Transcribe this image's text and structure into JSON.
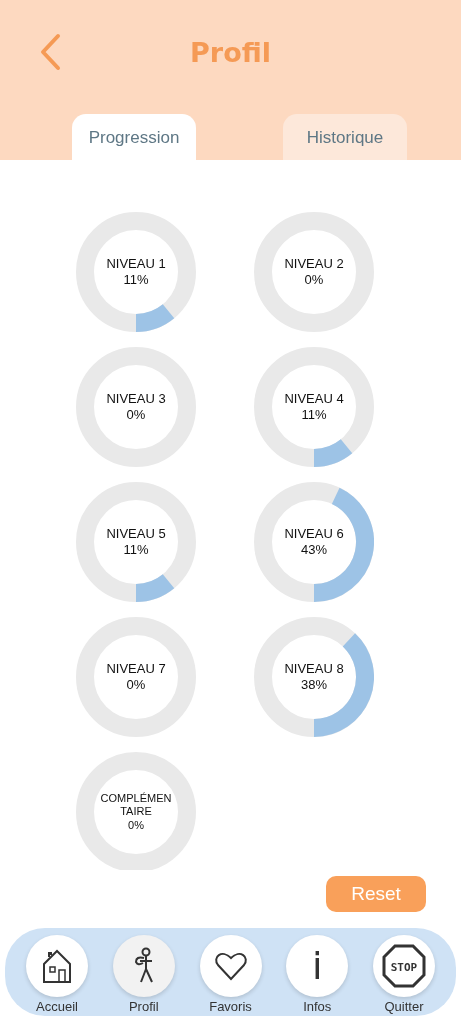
{
  "header": {
    "title": "Profil"
  },
  "tabs": [
    {
      "label": "Progression",
      "selected": true
    },
    {
      "label": "Historique",
      "selected": false
    }
  ],
  "levels": [
    {
      "name": "NIVEAU 1",
      "percent": "11%"
    },
    {
      "name": "NIVEAU 2",
      "percent": "0%"
    },
    {
      "name": "NIVEAU 3",
      "percent": "0%"
    },
    {
      "name": "NIVEAU 4",
      "percent": "11%"
    },
    {
      "name": "NIVEAU 5",
      "percent": "11%"
    },
    {
      "name": "NIVEAU 6",
      "percent": "43%"
    },
    {
      "name": "NIVEAU 7",
      "percent": "0%"
    },
    {
      "name": "NIVEAU 8",
      "percent": "38%"
    },
    {
      "name": "COMPLÉMENTAIRE",
      "percent": "0%"
    }
  ],
  "reset_button": "Reset",
  "nav": [
    {
      "label": "Accueil",
      "selected": false
    },
    {
      "label": "Profil",
      "selected": true
    },
    {
      "label": "Favoris",
      "selected": false
    },
    {
      "label": "Infos",
      "selected": false,
      "icon_text": "i"
    },
    {
      "label": "Quitter",
      "selected": false,
      "icon_text": "STOP"
    }
  ]
}
